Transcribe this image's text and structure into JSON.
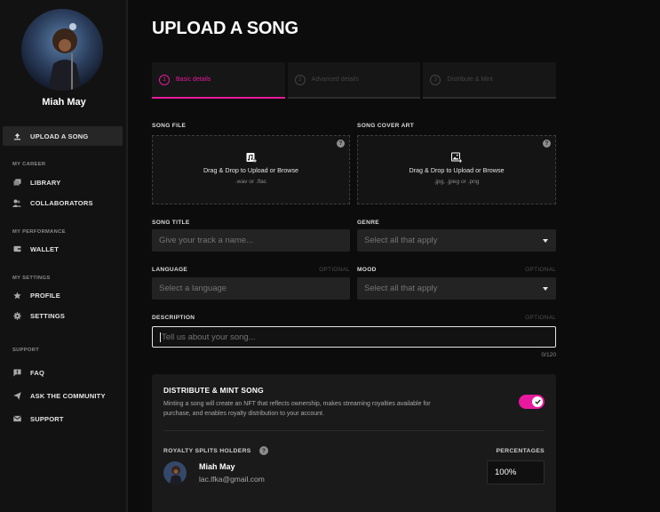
{
  "sidebar": {
    "artist_name": "Miah May",
    "active_item": {
      "label": "UPLOAD A SONG",
      "icon": "upload-icon"
    },
    "sections": [
      {
        "title": "MY CAREER",
        "items": [
          {
            "label": "LIBRARY",
            "icon": "library-icon"
          },
          {
            "label": "COLLABORATORS",
            "icon": "collaborators-icon"
          }
        ]
      },
      {
        "title": "MY PERFORMANCE",
        "items": [
          {
            "label": "WALLET",
            "icon": "wallet-icon"
          }
        ]
      },
      {
        "title": "MY SETTINGS",
        "items": [
          {
            "label": "PROFILE",
            "icon": "star-icon"
          },
          {
            "label": "SETTINGS",
            "icon": "gear-icon"
          }
        ]
      },
      {
        "title": "SUPPORT",
        "items": [
          {
            "label": "FAQ",
            "icon": "faq-icon"
          },
          {
            "label": "ASK THE COMMUNITY",
            "icon": "send-icon"
          },
          {
            "label": "SUPPORT",
            "icon": "mail-icon"
          }
        ]
      }
    ]
  },
  "main": {
    "title": "UPLOAD A SONG",
    "steps": [
      {
        "num": "1",
        "label": "Basic details",
        "active": true
      },
      {
        "num": "2",
        "label": "Advanced details",
        "active": false
      },
      {
        "num": "3",
        "label": "Distribute & Mint",
        "active": false
      }
    ],
    "song_file": {
      "label": "SONG FILE",
      "main": "Drag & Drop to Upload or Browse",
      "sub": ".wav or .flac",
      "help": "?"
    },
    "cover_art": {
      "label": "SONG COVER ART",
      "main": "Drag & Drop to Upload or Browse",
      "sub": ".jpg, .jpeg or .png",
      "help": "?"
    },
    "song_title": {
      "label": "SONG TITLE",
      "placeholder": "Give your track a name..."
    },
    "genre": {
      "label": "GENRE",
      "placeholder": "Select all that apply"
    },
    "language": {
      "label": "LANGUAGE",
      "optional": "OPTIONAL",
      "placeholder": "Select a language"
    },
    "mood": {
      "label": "MOOD",
      "optional": "OPTIONAL",
      "placeholder": "Select all that apply"
    },
    "description": {
      "label": "DESCRIPTION",
      "optional": "OPTIONAL",
      "placeholder": "Tell us about your song...",
      "counter": "0/120"
    },
    "distribute": {
      "title": "DISTRIBUTE & MINT SONG",
      "description": "Minting a song will create an NFT that reflects ownership, makes streaming royalties available for purchase, and enables royalty distribution to your account.",
      "toggle_on": true,
      "royalty_label": "ROYALTY SPLITS HOLDERS",
      "royalty_help": "?",
      "percentages_label": "PERCENTAGES",
      "holder": {
        "name": "Miah May",
        "email": "lac.lfka@gmail.com",
        "percentage": "100%"
      }
    }
  },
  "colors": {
    "accent": "#e8199c",
    "background": "#0c0c0c",
    "sidebar": "#121212",
    "input": "#232323"
  }
}
